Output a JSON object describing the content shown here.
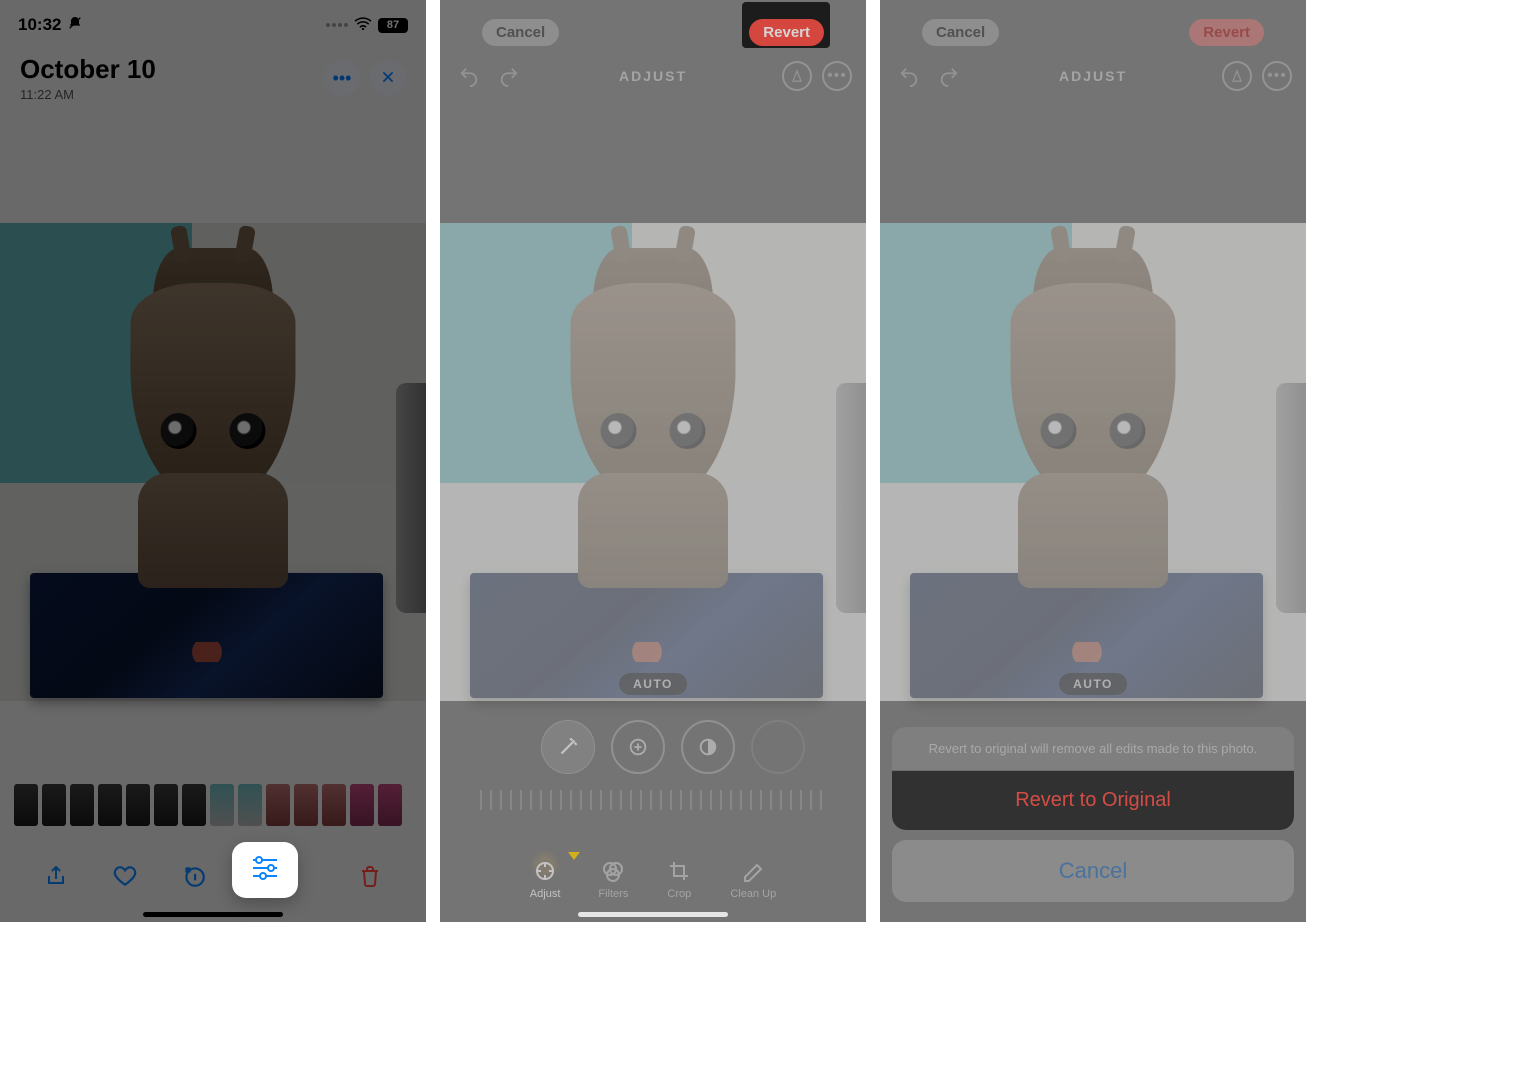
{
  "panel1": {
    "status": {
      "time": "10:32",
      "battery": "87"
    },
    "header": {
      "title": "October 10",
      "subtitle": "11:22 AM"
    }
  },
  "panel2": {
    "top": {
      "cancel": "Cancel",
      "revert": "Revert"
    },
    "mid_title": "ADJUST",
    "auto_label": "AUTO",
    "tools": {
      "adjust": "Adjust",
      "filters": "Filters",
      "crop": "Crop",
      "cleanup": "Clean Up"
    }
  },
  "panel3": {
    "top": {
      "cancel": "Cancel",
      "revert": "Revert"
    },
    "mid_title": "ADJUST",
    "auto_label": "AUTO",
    "sheet": {
      "message": "Revert to original will remove all edits made to this photo.",
      "action": "Revert to Original",
      "cancel": "Cancel"
    }
  }
}
